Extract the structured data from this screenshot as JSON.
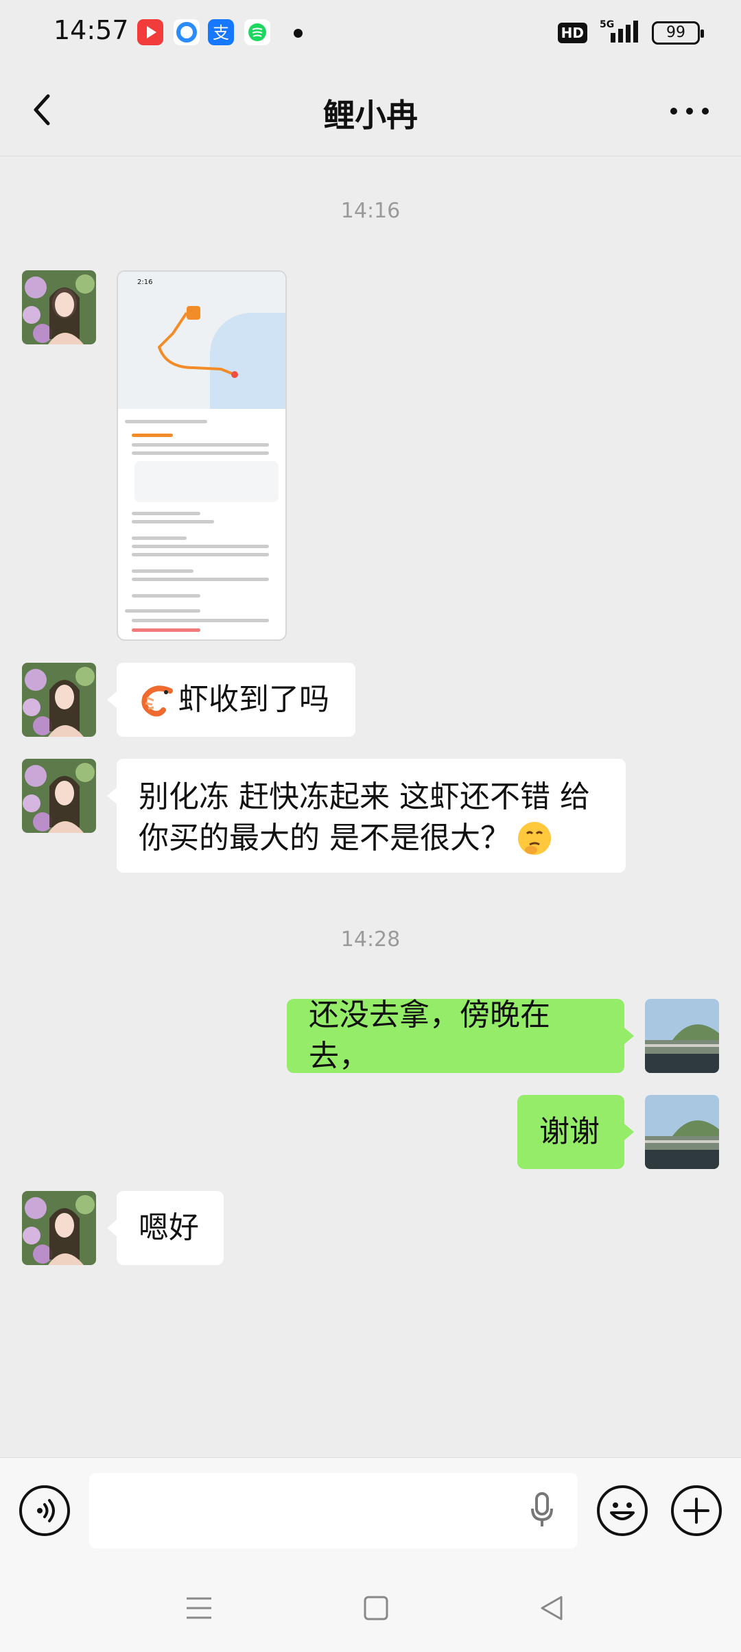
{
  "status_bar": {
    "time": "14:57",
    "app_icons": [
      {
        "name": "video-app-icon",
        "color": "#f23c3c"
      },
      {
        "name": "browser-app-icon",
        "color": "#2b8cff"
      },
      {
        "name": "alipay-app-icon",
        "color": "#1677ff"
      },
      {
        "name": "music-app-icon",
        "color": "#1ed760"
      }
    ],
    "hd_label": "HD",
    "network_label": "5G",
    "battery_level": "99"
  },
  "header": {
    "title": "鲤小冉"
  },
  "messages": {
    "time_1": "14:16",
    "msg_2": "虾收到了吗",
    "msg_3_line_1": "别化冻 赶快冻起来 这虾还不错 给",
    "msg_3_line_2": "你买的最大的 是不是很大？",
    "time_2": "14:28",
    "msg_4": "还没去拿，傍晚在去，",
    "msg_5": "谢谢",
    "msg_6": "嗯好"
  },
  "screenshot_preview": {
    "time": "2:16"
  },
  "colors": {
    "background": "#ededed",
    "bubble_left": "#ffffff",
    "bubble_right": "#95ec69"
  }
}
